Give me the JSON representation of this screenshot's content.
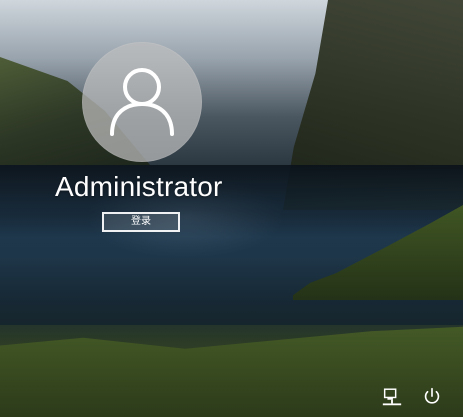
{
  "lock_screen": {
    "user": {
      "display_name": "Administrator"
    },
    "signin_button_label": "登录",
    "icons": {
      "avatar": "user-avatar-icon",
      "network": "network-icon",
      "power": "power-icon"
    }
  },
  "colors": {
    "text": "#ffffff",
    "avatar_bg": "#bebebe",
    "button_border": "#ffffff"
  }
}
